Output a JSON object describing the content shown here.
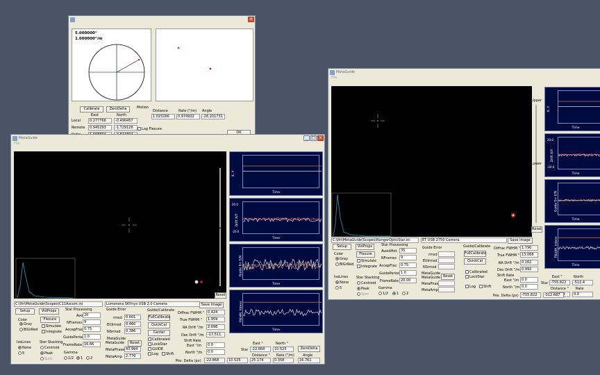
{
  "colors": {
    "desktop": "#4b5367",
    "plot_bg": "#000a3e",
    "accent": "#d9532c"
  },
  "dialog": {
    "readout_angle": "5.000000°",
    "readout_rate": "1.000000°/m",
    "calibrate": "Calibrate",
    "zero_delta": "ZeroDelta",
    "col_east": "East",
    "col_north": "North",
    "rows": [
      {
        "label": "Local",
        "east": "0.277766",
        "north": "-0.490457"
      },
      {
        "label": "Remote",
        "east": "0.945293",
        "north": "-1.729126"
      },
      {
        "label": "Delta",
        "east": "1.008894",
        "north": "-0.644804"
      }
    ],
    "motion": "Motion",
    "distance_label": "Distance",
    "rate_label": "Rate (°/m)",
    "angle_label": "Angle",
    "distance": "1.023166",
    "rate": "0.974922",
    "angle": "-26.201731",
    "log_flexure": "Log Flexure",
    "ok": "OK"
  },
  "left": {
    "title": "MetaGuide",
    "menu": "File",
    "upper": "Upper",
    "lower": "Lower",
    "reset": "Reset",
    "plots": [
      {
        "ylabel": "X, Y",
        "xlabel": "Time",
        "tick_top": "",
        "tick_bot": ""
      },
      {
        "ylabel": "Drift X/Y",
        "xlabel": "Time",
        "tick_top": "20.0",
        "tick_bot": "-20.0"
      },
      {
        "ylabel": "Guide Err E/N",
        "xlabel": "Time",
        "tick_top": "",
        "tick_bot": ""
      },
      {
        "ylabel": "FWHM, Intens",
        "xlabel": "Time",
        "tick_top": "",
        "tick_bot": ""
      }
    ],
    "scope_path": "C:\\lfn\\MetaGuide\\Scopes\\C11Ascom.ini",
    "camera": "Lumenera SKYnyx USB 2.0 Camera",
    "save_image": "Save Image",
    "setup": "Setup",
    "vidprops": "VidProps",
    "flexure": "Flexure",
    "simulate": "Simulate",
    "integrate": "Integrate",
    "color": "Color",
    "gray": "Gray",
    "bgred": "BlGrRed",
    "isolines": "IsoLines",
    "none": "None",
    "five": "5",
    "star_stacking": "Star Stacking",
    "centroid": "Centroid",
    "peak": "Peak",
    "sum": "Sum",
    "star_processing": "Star Processing",
    "avoidhot": "AvoidHot",
    "avoidhot_v": "20",
    "nframes": "NFrames",
    "nframes_v": "9",
    "accepfrac": "AccepFrac",
    "accepfrac_v": "0.75",
    "guideperiod": "GuidePeriod",
    "guideperiod_v": "1.0",
    "framerate": "FrameRate",
    "framerate_v": "16.66",
    "guide_error": "Guide Error",
    "rmsd": "rmsd",
    "rmsd_v": "0.601",
    "elitrmsd": "EltIrmsd",
    "elitrmsd_v": "0.460",
    "nsrmsd": "NSrmsd",
    "nsrmsd_v": "0.386",
    "metaguide": "MetaGuide",
    "mg2": "MetaGuide",
    "reset_btn": "Reset",
    "metaphase": "MetaPhase",
    "metaphase_v": "43.994",
    "metaamp": "MetaAmp",
    "metaamp_v": "2.770",
    "gamma": "Gamma",
    "g_half": "1/2",
    "g_one": "1",
    "g_two": "2",
    "guide_cal": "Guide/Calibrate",
    "fullcal": "FullCalibrate",
    "quickcal": "QuickCal",
    "center": "Center",
    "calibrated": "Calibrated",
    "lockstar": "LockStar",
    "guide": "GUIDE",
    "log": "Log",
    "shift": "Shift",
    "diffrac_l": "Diffrac FWHM \"",
    "diffrac_v": "0.424",
    "truefwhm_l": "True FWHM \"",
    "truefwhm_v": "1.959",
    "radrift_l": "RA Drift \"/m",
    "radrift_v": "2.698",
    "decdrift_l": "Dec Drift \"/m",
    "decdrift_v": "-17.511",
    "shiftrate": "Shift Rate",
    "east_l": "East \"/m",
    "east_v": "0.0",
    "north_l": "North \"/m",
    "north_v": "0.0",
    "star": "Star",
    "east_h": "East \"",
    "north_h": "North \"",
    "star_e": "-22.868",
    "star_n": "10.525",
    "zerodelta": "ZeroDelta",
    "distance_h": "Distance \"",
    "rate_h": "Rate (\"/m)",
    "angle_h": "Angle",
    "dist_v": "25.174",
    "rate_v": "0.358",
    "angle_v": "16.761",
    "posdelta": "Pos. Delta (px)",
    "pd_e": "-22.868",
    "pd_n": "10.525"
  },
  "right": {
    "title": "MetaGuide",
    "menu": "File",
    "upper": "Upper",
    "lower": "Lower",
    "reset": "Reset",
    "plots": [
      {
        "ylabel": "X, Y",
        "xlabel": "Time",
        "tick_top": "",
        "tick_bot": ""
      },
      {
        "ylabel": "Drift X/Y",
        "xlabel": "Time",
        "tick_top": "20.0",
        "tick_bot": "-20.0"
      },
      {
        "ylabel": "Guide Err E/N",
        "xlabel": "Time",
        "tick_top": "",
        "tick_bot": ""
      },
      {
        "ylabel": "FWHM, Intens",
        "xlabel": "Time",
        "tick_top": "",
        "tick_bot": ""
      }
    ],
    "scope_path": "C:\\lfn\\MetaGuide\\Scopes\\RangerOpticStar.ini",
    "camera": "ET USB 2750 Camera",
    "save_image": "Save Image",
    "setup": "Setup",
    "vidprops": "VidProps",
    "flexure": "Flexure",
    "simulate": "Simulate",
    "integrate": "Integrate",
    "color": "Color",
    "gray": "Gray",
    "bgred": "BlGrRed",
    "isolines": "IsoLines",
    "none": "None",
    "five": "5",
    "star_stacking": "Star Stacking",
    "centroid": "Centroid",
    "peak": "Peak",
    "sum": "Sum",
    "star_processing": "Star Processing",
    "avoidhot": "AvoidHot",
    "avoidhot_v": "35",
    "nframes": "NFrames",
    "nframes_v": "9",
    "accepfrac": "AccepFrac",
    "accepfrac_v": "0.75",
    "guideperiod": "GuidePeriod",
    "guideperiod_v": "1.0",
    "framerate": "FrameRate",
    "framerate_v": "20.00",
    "guide_error": "Guide Error",
    "rmsd": "rmsd",
    "elitrmsd": "EltIrmsd",
    "nsrmsd": "NSrmsd",
    "metaguide": "MetaGuide",
    "mg2": "MetaGuide",
    "reset_btn": "Reset",
    "metaphase": "MetaPhase",
    "metaamp": "MetaAmp",
    "gamma": "Gamma",
    "g_half": "1/2",
    "g_one": "1",
    "g_two": "2",
    "guide_cal": "Guide/Calibrate",
    "fullcal": "FullCalibrate",
    "quickcal": "QuickCal",
    "calibrated": "Calibrated",
    "lockstar": "LockStar",
    "log": "Log",
    "shift": "Shift",
    "diffrac_l": "Diffrac FWHM \"",
    "diffrac_v": "1.790",
    "truefwhm_l": "True FWHM \"",
    "truefwhm_v": "13.068",
    "radrift_l": "RA Drift \"/m",
    "radrift_v": "0.162",
    "decdrift_l": "Dec Drift \"/m",
    "decdrift_v": "0.992",
    "shiftrate": "Shift Rate",
    "east_l": "East \"/m",
    "east_v": "0.0",
    "north_l": "North \"/m",
    "north_v": "0.0",
    "star": "Star",
    "east_h": "East \"",
    "north_h": "North",
    "star_e": "-755.822",
    "star_n": "-512.4",
    "distance_h": "Distance \"",
    "rate_h": "Rate",
    "dist_v": "913.299",
    "rate_v": "0.0",
    "posdelta": "Pos. Delta (px)",
    "pd_e": "-755.822",
    "pd_n": "-512.687",
    "pd_x": "0.0"
  }
}
